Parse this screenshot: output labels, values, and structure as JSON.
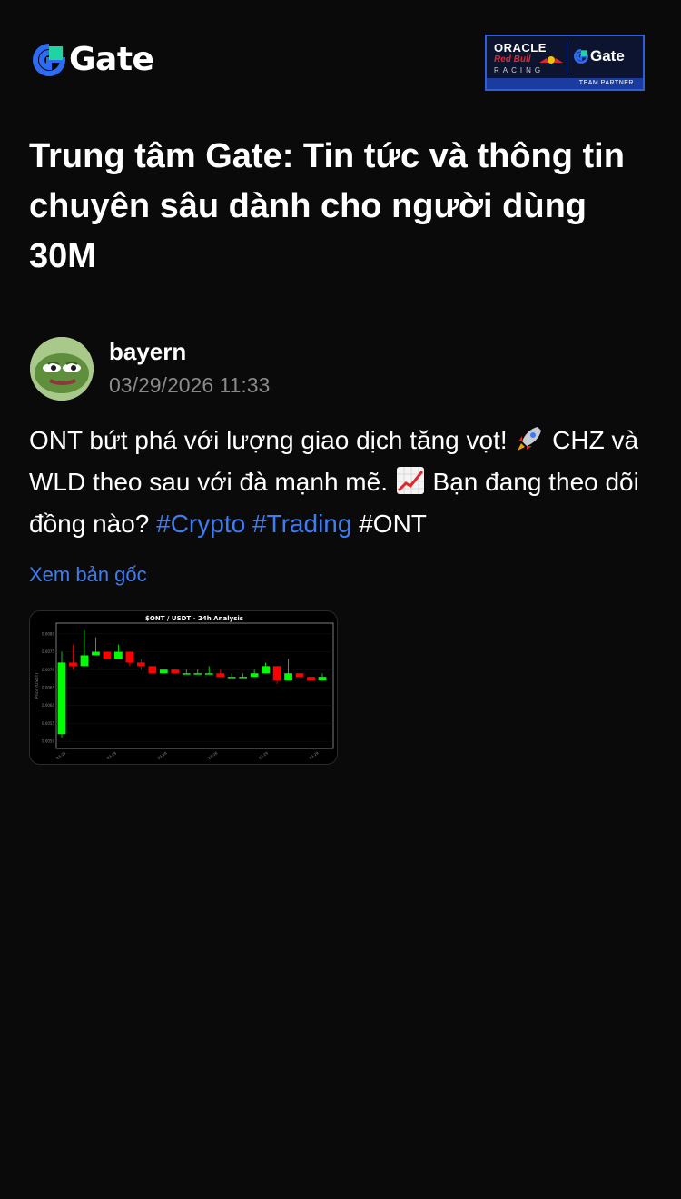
{
  "header": {
    "logo_text": "Gate",
    "partner": {
      "oracle": "ORACLE",
      "redbull": "Red Bull",
      "racing": "RACING",
      "gate": "Gate",
      "team_partner": "TEAM PARTNER"
    }
  },
  "page_title": "Trung tâm Gate: Tin tức và thông tin chuyên sâu dành cho người dùng 30M",
  "post": {
    "author": "bayern",
    "timestamp": "03/29/2026 11:33",
    "text_part1": "ONT bứt phá với lượng giao dịch tăng vọt! ",
    "text_part2": " CHZ và WLD theo sau với đà mạnh mẽ. ",
    "text_part3": " Bạn đang theo dõi đồng nào? ",
    "hashtag_1": "#Crypto",
    "hashtag_2": "#Trading",
    "hashtag_3": "#ONT",
    "emoji_1": "rocket-icon",
    "emoji_2": "chart-increasing-icon",
    "view_original": "Xem bản gốc"
  },
  "colors": {
    "background": "#0a0a0a",
    "link": "#3d7cf2",
    "muted": "#8a8a8a",
    "up": "#00ff00",
    "down": "#ff0000"
  },
  "chart_data": {
    "type": "candlestick",
    "title": "$ONT / USDT - 24h Analysis",
    "ylabel": "Price (USDT)",
    "yticks": [
      "0.0050",
      "0.0055",
      "0.0060",
      "0.0065",
      "0.0070",
      "0.0075",
      "0.0080"
    ],
    "xticks": [
      "03-28",
      "03-28",
      "03-28",
      "03-28",
      "03-29",
      "03-29"
    ],
    "ylim": [
      0.0048,
      0.0083
    ],
    "candles": [
      {
        "o": 0.0052,
        "h": 0.0075,
        "l": 0.0051,
        "c": 0.0072
      },
      {
        "o": 0.0072,
        "h": 0.0077,
        "l": 0.007,
        "c": 0.0071
      },
      {
        "o": 0.0071,
        "h": 0.0081,
        "l": 0.0071,
        "c": 0.0074
      },
      {
        "o": 0.0074,
        "h": 0.0079,
        "l": 0.0074,
        "c": 0.0075
      },
      {
        "o": 0.0075,
        "h": 0.0075,
        "l": 0.0073,
        "c": 0.0073
      },
      {
        "o": 0.0073,
        "h": 0.0077,
        "l": 0.0073,
        "c": 0.0075
      },
      {
        "o": 0.0075,
        "h": 0.0075,
        "l": 0.0071,
        "c": 0.0072
      },
      {
        "o": 0.0072,
        "h": 0.0073,
        "l": 0.007,
        "c": 0.0071
      },
      {
        "o": 0.0071,
        "h": 0.0071,
        "l": 0.0069,
        "c": 0.0069
      },
      {
        "o": 0.0069,
        "h": 0.007,
        "l": 0.0069,
        "c": 0.007
      },
      {
        "o": 0.007,
        "h": 0.007,
        "l": 0.0069,
        "c": 0.0069
      },
      {
        "o": 0.0069,
        "h": 0.007,
        "l": 0.0069,
        "c": 0.0069
      },
      {
        "o": 0.0069,
        "h": 0.007,
        "l": 0.0069,
        "c": 0.0069
      },
      {
        "o": 0.0069,
        "h": 0.0071,
        "l": 0.0069,
        "c": 0.0069
      },
      {
        "o": 0.0069,
        "h": 0.007,
        "l": 0.0068,
        "c": 0.0068
      },
      {
        "o": 0.0068,
        "h": 0.0069,
        "l": 0.0068,
        "c": 0.0068
      },
      {
        "o": 0.0068,
        "h": 0.0069,
        "l": 0.0068,
        "c": 0.0068
      },
      {
        "o": 0.0068,
        "h": 0.007,
        "l": 0.0068,
        "c": 0.0069
      },
      {
        "o": 0.0069,
        "h": 0.0072,
        "l": 0.0069,
        "c": 0.0071
      },
      {
        "o": 0.0071,
        "h": 0.0071,
        "l": 0.0066,
        "c": 0.0067
      },
      {
        "o": 0.0067,
        "h": 0.0073,
        "l": 0.0067,
        "c": 0.0069
      },
      {
        "o": 0.0069,
        "h": 0.0069,
        "l": 0.0068,
        "c": 0.0068
      },
      {
        "o": 0.0068,
        "h": 0.0068,
        "l": 0.0067,
        "c": 0.0067
      },
      {
        "o": 0.0067,
        "h": 0.0069,
        "l": 0.0067,
        "c": 0.0068
      }
    ]
  }
}
